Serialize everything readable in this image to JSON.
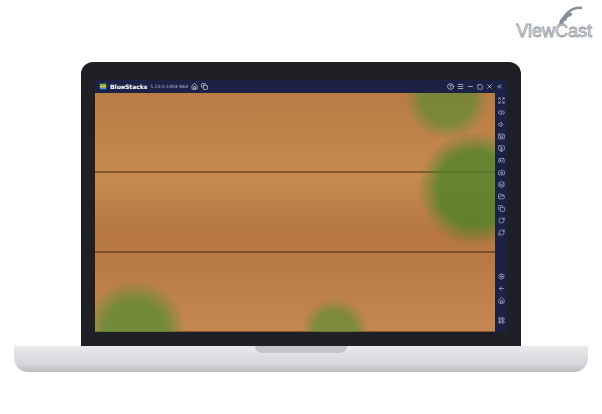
{
  "watermark": "ViewCast",
  "window": {
    "title": "BlueStacks",
    "version": "5.10.0.1004 N64"
  }
}
